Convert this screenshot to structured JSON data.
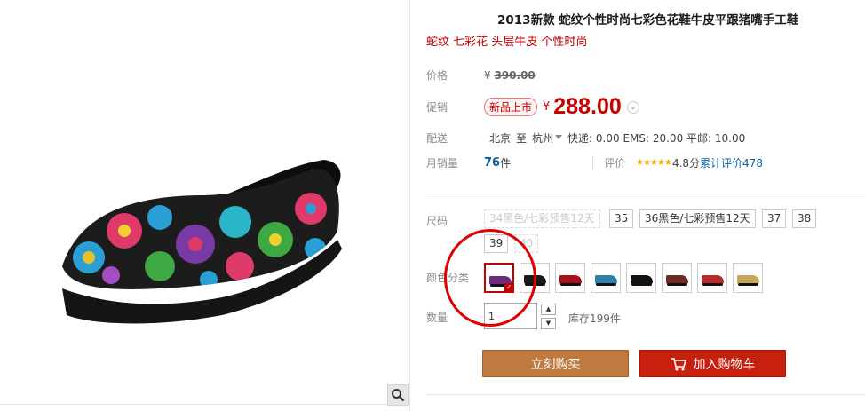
{
  "gallery": {
    "zoom_icon": "magnifier-icon"
  },
  "product": {
    "title": "2013新款 蛇纹个性时尚七彩色花鞋牛皮平跟猪嘴手工鞋",
    "subtitle": "蛇纹 七彩花 头层牛皮 个性时尚"
  },
  "price": {
    "label": "价格",
    "currency": "¥",
    "original": "390.00"
  },
  "promo": {
    "label": "促销",
    "badge": "新品上市",
    "currency": "¥",
    "price": "288.00"
  },
  "shipping": {
    "label": "配送",
    "from": "北京",
    "to_word": "至",
    "to": "杭州",
    "fees": "快递: 0.00 EMS: 20.00 平邮: 10.00"
  },
  "sales": {
    "label": "月销量",
    "count": "76",
    "unit": "件",
    "rating_label": "评价",
    "stars": "★★★★★",
    "score": "4.8分",
    "review_link": "累计评价478"
  },
  "sizes": {
    "label": "尺码",
    "options": [
      "34黑色/七彩预售12天",
      "35",
      "36黑色/七彩预售12天",
      "37",
      "38",
      "39",
      "40"
    ]
  },
  "colors": {
    "label": "颜色分类",
    "swatches": [
      "#6e2a7a",
      "#1b1b1b",
      "#a3121d",
      "#2d7fa8",
      "#111111",
      "#6d2b22",
      "#b52a2a",
      "#c9a75a"
    ],
    "selected_index": 0
  },
  "quantity": {
    "label": "数量",
    "value": "1",
    "stock": "库存199件"
  },
  "actions": {
    "buy": "立刻购买",
    "cart": "加入购物车"
  },
  "theme": {
    "accent": "#c40000",
    "buy_color": "#c07a3f",
    "cart_color": "#c8200e",
    "annotation": "#e00000"
  }
}
